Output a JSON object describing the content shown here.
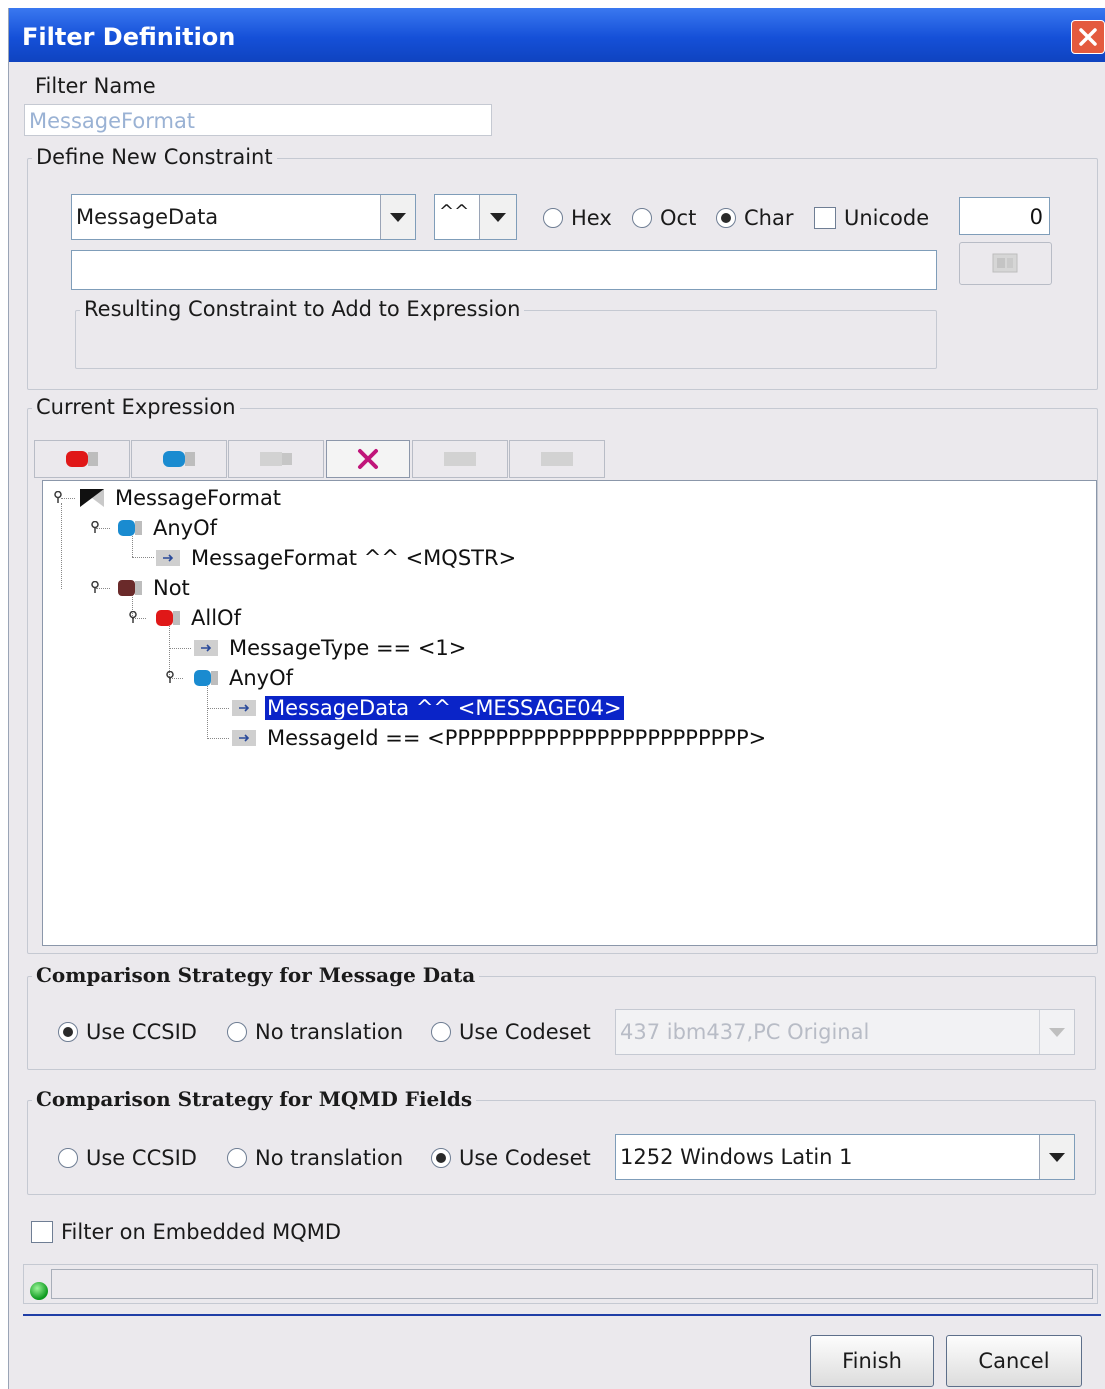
{
  "window": {
    "title": "Filter Definition"
  },
  "filter_name": {
    "label": "Filter Name",
    "value": "MessageFormat"
  },
  "define_constraint": {
    "legend": "Define New Constraint",
    "field_select": "MessageData",
    "operator_select": "^^",
    "radio_hex": "Hex",
    "radio_oct": "Oct",
    "radio_char": "Char",
    "selected_radio": "Char",
    "unicode_label": "Unicode",
    "offset_value": "0",
    "value_input": "",
    "resulting_legend": "Resulting Constraint to Add to Expression"
  },
  "current_expression": {
    "legend": "Current Expression",
    "toolbar": [
      "add-allof",
      "add-anyof",
      "add-not",
      "delete",
      "move-up",
      "move-down"
    ],
    "tree": [
      {
        "label": "MessageFormat",
        "depth": 0,
        "icon": "root-icon"
      },
      {
        "label": "AnyOf",
        "depth": 1,
        "icon": "anyof-icon"
      },
      {
        "label": "MessageFormat ^^ <MQSTR>",
        "depth": 2,
        "icon": "constraint-icon"
      },
      {
        "label": "Not",
        "depth": 1,
        "icon": "not-icon"
      },
      {
        "label": "AllOf",
        "depth": 2,
        "icon": "allof-icon"
      },
      {
        "label": "MessageType == <1>",
        "depth": 3,
        "icon": "constraint-icon"
      },
      {
        "label": "AnyOf",
        "depth": 3,
        "icon": "anyof-icon"
      },
      {
        "label": "MessageData ^^ <MESSAGE04>",
        "depth": 4,
        "icon": "constraint-icon",
        "selected": true
      },
      {
        "label": "MessageId == <PPPPPPPPPPPPPPPPPPPPPPPP>",
        "depth": 4,
        "icon": "constraint-icon"
      }
    ]
  },
  "message_data_strategy": {
    "legend": "Comparison Strategy for Message Data",
    "use_ccsid": "Use CCSID",
    "no_translation": "No translation",
    "use_codeset": "Use Codeset",
    "selected": "Use CCSID",
    "codeset_value": "437  ibm437,PC Original"
  },
  "mqmd_strategy": {
    "legend": "Comparison Strategy for MQMD Fields",
    "use_ccsid": "Use CCSID",
    "no_translation": "No translation",
    "use_codeset": "Use Codeset",
    "selected": "Use Codeset",
    "codeset_value": "1252  Windows Latin 1"
  },
  "embedded": {
    "label": "Filter on Embedded MQMD"
  },
  "buttons": {
    "finish": "Finish",
    "cancel": "Cancel"
  }
}
